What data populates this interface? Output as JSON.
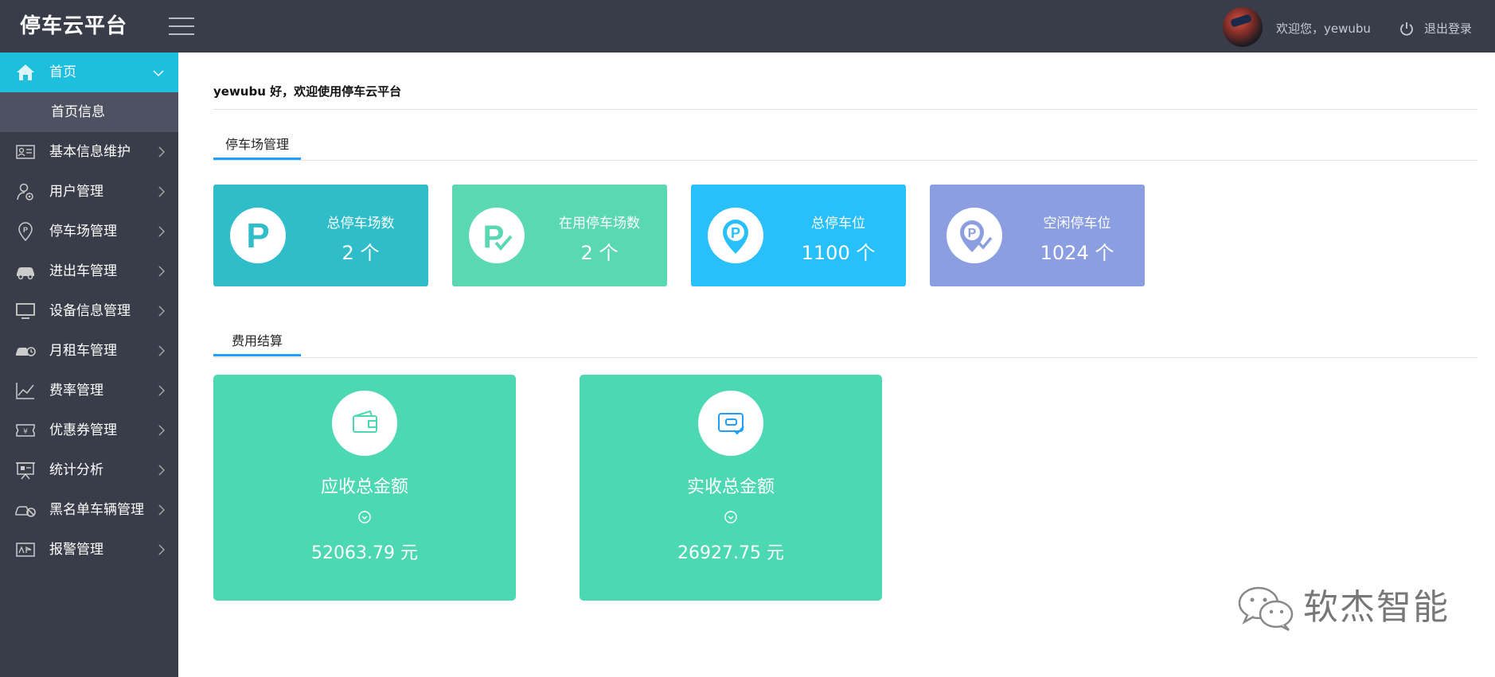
{
  "header": {
    "brand": "停车云平台",
    "welcome": "欢迎您，yewubu",
    "logout": "退出登录"
  },
  "sidebar": {
    "items": [
      {
        "label": "首页",
        "icon": "home-icon",
        "expanded": true
      },
      {
        "label": "基本信息维护",
        "icon": "id-card-icon"
      },
      {
        "label": "用户管理",
        "icon": "user-settings-icon"
      },
      {
        "label": "停车场管理",
        "icon": "parking-pin-icon"
      },
      {
        "label": "进出车管理",
        "icon": "car-icon"
      },
      {
        "label": "设备信息管理",
        "icon": "monitor-icon"
      },
      {
        "label": "月租车管理",
        "icon": "car-clock-icon"
      },
      {
        "label": "费率管理",
        "icon": "line-chart-icon"
      },
      {
        "label": "优惠券管理",
        "icon": "coupon-icon"
      },
      {
        "label": "统计分析",
        "icon": "presentation-icon"
      },
      {
        "label": "黑名单车辆管理",
        "icon": "car-banned-icon"
      },
      {
        "label": "报警管理",
        "icon": "alarm-board-icon"
      }
    ],
    "sub_items": [
      {
        "label": "首页信息"
      }
    ]
  },
  "main": {
    "greeting": "yewubu 好，欢迎使用停车云平台",
    "parking_section": {
      "title": "停车场管理",
      "cards": [
        {
          "title": "总停车场数",
          "value": "2 个",
          "color": "#2ebdc9",
          "icon": "parking-icon"
        },
        {
          "title": "在用停车场数",
          "value": "2 个",
          "color": "#5ad8b2",
          "icon": "parking-check-icon"
        },
        {
          "title": "总停车位",
          "value": "1100 个",
          "color": "#27c0fb",
          "icon": "parking-pin-icon"
        },
        {
          "title": "空闲停车位",
          "value": "1024 个",
          "color": "#8a9ee1",
          "icon": "parking-free-icon"
        }
      ]
    },
    "fee_section": {
      "title": "费用结算",
      "cards": [
        {
          "title": "应收总金额",
          "value": "52063.79 元",
          "icon": "wallet-icon"
        },
        {
          "title": "实收总金额",
          "value": "26927.75 元",
          "icon": "wallet-check-icon"
        }
      ]
    }
  },
  "watermark": {
    "text": "软杰智能",
    "icon": "wechat-icon"
  },
  "colors": {
    "topbar": "#393d49",
    "sidebar_active": "#1ebedf",
    "tab_underline": "#1e9fff",
    "fee_card": "#4cd8b3"
  }
}
